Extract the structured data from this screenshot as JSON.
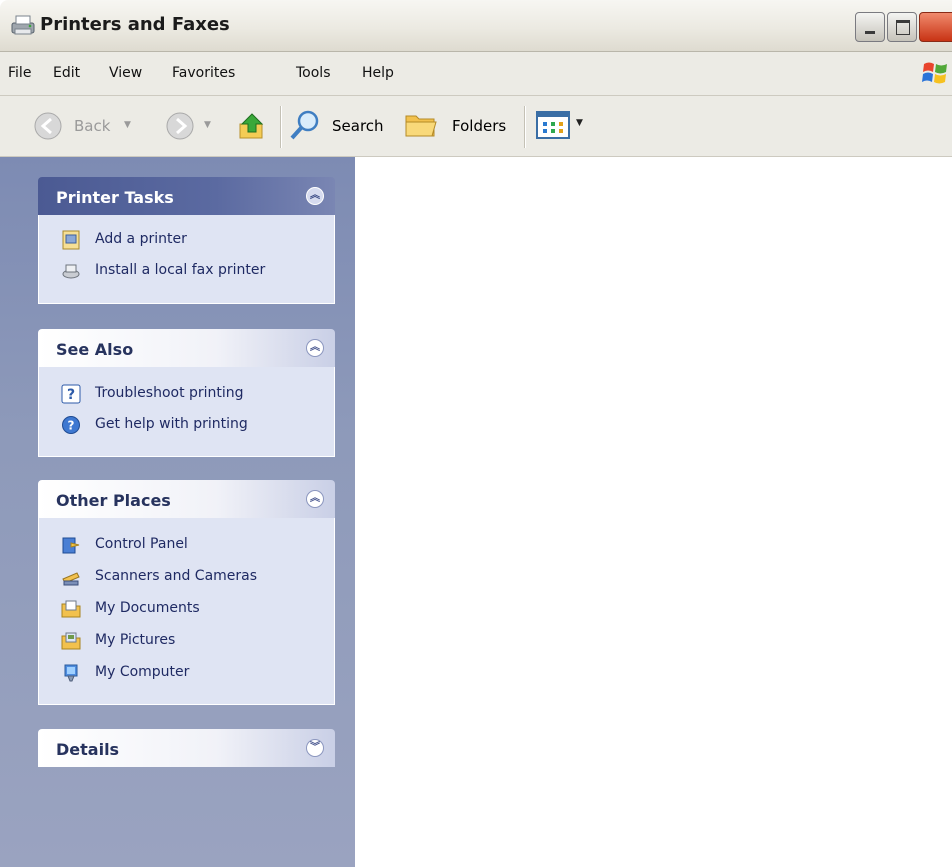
{
  "window": {
    "title": "Printers and Faxes"
  },
  "menu": {
    "items": [
      "File",
      "Edit",
      "View",
      "Favorites",
      "Tools",
      "Help"
    ]
  },
  "toolbar": {
    "back_label": "Back",
    "search_label": "Search",
    "folders_label": "Folders"
  },
  "panels": {
    "printer_tasks": {
      "title": "Printer Tasks",
      "items": [
        {
          "label": "Add a printer",
          "icon": "add-printer-icon"
        },
        {
          "label": "Install a local fax printer",
          "icon": "fax-icon"
        }
      ]
    },
    "see_also": {
      "title": "See Also",
      "items": [
        {
          "label": "Troubleshoot printing",
          "icon": "help-question-icon"
        },
        {
          "label": "Get help with printing",
          "icon": "help-globe-icon"
        }
      ]
    },
    "other_places": {
      "title": "Other Places",
      "items": [
        {
          "label": "Control Panel",
          "icon": "control-panel-icon"
        },
        {
          "label": "Scanners and Cameras",
          "icon": "scanner-icon"
        },
        {
          "label": "My Documents",
          "icon": "my-documents-icon"
        },
        {
          "label": "My Pictures",
          "icon": "my-pictures-icon"
        },
        {
          "label": "My Computer",
          "icon": "my-computer-icon"
        }
      ]
    },
    "details": {
      "title": "Details"
    }
  },
  "colors": {
    "task_pane_bg": "#8e9aba",
    "panel_body_bg": "#dfe4f3",
    "panel_header_dark": "#4b5a93",
    "link_text": "#1f2a63"
  }
}
